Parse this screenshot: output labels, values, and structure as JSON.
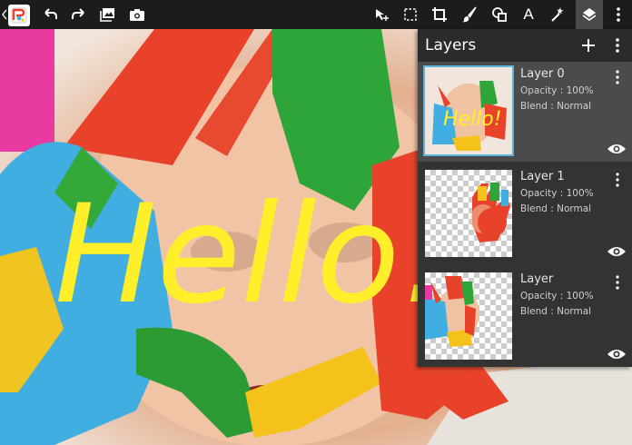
{
  "toolbar": {
    "tools": [
      {
        "id": "undo",
        "icon": "undo-icon"
      },
      {
        "id": "redo",
        "icon": "redo-icon"
      },
      {
        "id": "gallery",
        "icon": "image-icon"
      },
      {
        "id": "camera",
        "icon": "camera-icon"
      },
      {
        "id": "move",
        "icon": "move-icon"
      },
      {
        "id": "select",
        "icon": "selection-icon"
      },
      {
        "id": "crop",
        "icon": "crop-icon"
      },
      {
        "id": "brush",
        "icon": "brush-icon"
      },
      {
        "id": "shape",
        "icon": "shape-icon"
      },
      {
        "id": "text",
        "icon": "text-icon",
        "label": "A"
      },
      {
        "id": "magic",
        "icon": "magic-wand-icon"
      },
      {
        "id": "layers",
        "icon": "layers-icon",
        "active": true
      },
      {
        "id": "more",
        "icon": "more-vertical-icon"
      }
    ]
  },
  "canvas": {
    "drawn_text": "Hello!",
    "text_color": "#ffef2a"
  },
  "layers_panel": {
    "title": "Layers",
    "add_icon": "plus-icon",
    "menu_icon": "more-vertical-icon",
    "layers": [
      {
        "name": "Layer 0",
        "opacity": "Opacity : 100%",
        "blend": "Blend : Normal",
        "selected": true,
        "visible": true
      },
      {
        "name": "Layer 1",
        "opacity": "Opacity : 100%",
        "blend": "Blend : Normal",
        "selected": false,
        "visible": true
      },
      {
        "name": "Layer",
        "opacity": "Opacity : 100%",
        "blend": "Blend : Normal",
        "selected": false,
        "visible": true
      }
    ]
  },
  "colors": {
    "toolbar_bg": "#1c1c1c",
    "panel_bg": "#333333",
    "selected_row": "#4b4b4b",
    "accent": "#5fb3d9"
  }
}
